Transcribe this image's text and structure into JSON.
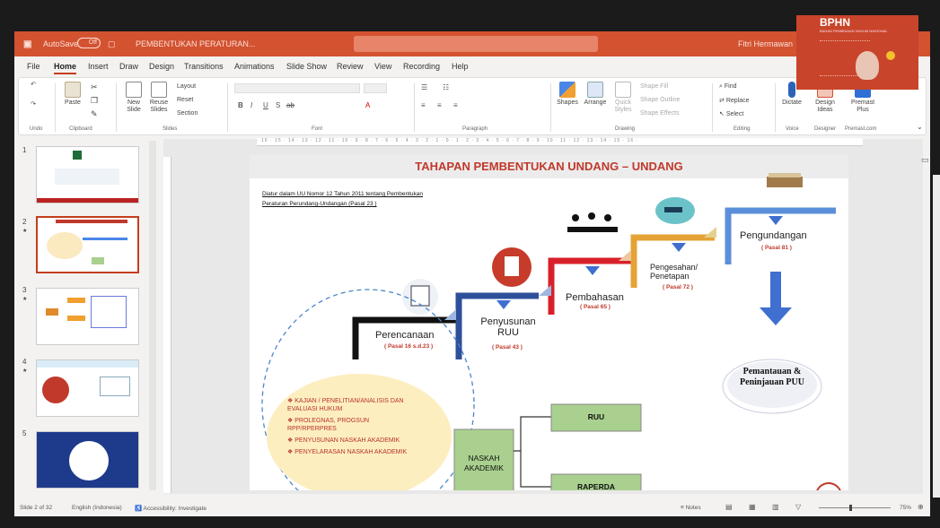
{
  "titlebar": {
    "autosave": "AutoSave",
    "toggle": "Off",
    "doc_title": "PEMBENTUKAN PERATURAN...",
    "user": "Fitri Hermawan"
  },
  "menu": [
    "File",
    "Home",
    "Insert",
    "Draw",
    "Design",
    "Transitions",
    "Animations",
    "Slide Show",
    "Review",
    "View",
    "Recording",
    "Help"
  ],
  "ribbon": {
    "undo": "Undo",
    "paste": "Paste",
    "clipboard": "Clipboard",
    "new_slide": "New Slide",
    "reuse_slides": "Reuse Slides",
    "layout": "Layout",
    "reset": "Reset",
    "section": "Section",
    "slides": "Slides",
    "font": "Font",
    "paragraph": "Paragraph",
    "shapes": "Shapes",
    "arrange": "Arrange",
    "quick_styles": "Quick Styles",
    "shape_fill": "Shape Fill",
    "shape_outline": "Shape Outline",
    "shape_effects": "Shape Effects",
    "drawing": "Drawing",
    "find": "Find",
    "replace": "Replace",
    "select": "Select",
    "editing": "Editing",
    "dictate": "Dictate",
    "voice": "Voice",
    "design_ideas": "Design Ideas",
    "designer": "Designer",
    "premast_plus": "Premast Plus",
    "premast": "Premast.com"
  },
  "ruler": "· 16 · 15 · 14 · 13 · 12 · 11 · 10 · 9 · 8 · 7 · 6 · 5 · 4 · 3 · 2 · 1 · 0 · 1 · 2 · 3 · 4 · 5 · 6 · 7 · 8 · 9 · 10 · 11 · 12 · 13 · 14 · 15 · 16 ·",
  "thumbnails": [
    {
      "num": "1",
      "star": ""
    },
    {
      "num": "2",
      "star": "★"
    },
    {
      "num": "3",
      "star": "★"
    },
    {
      "num": "4",
      "star": "★"
    },
    {
      "num": "5",
      "star": ""
    }
  ],
  "slide": {
    "title": "TAHAPAN PEMBENTUKAN UNDANG – UNDANG",
    "subtitle_line1": "Diatur dalam UU Nomor 12 Tahun 2011 tentang Pembentukan",
    "subtitle_line2": "Peraturan Perundang-Undangan (Pasal 23 )",
    "steps": [
      {
        "label": "Perencanaan",
        "pasal": "( Pasal 16 s.d.23 )"
      },
      {
        "label": "Penyusunan RUU",
        "pasal": "( Pasal 43 )"
      },
      {
        "label": "Pembahasan",
        "pasal": "( Pasal 65 )"
      },
      {
        "label": "Pengesahan/ Penetapan",
        "pasal": "( Pasal 72 )"
      },
      {
        "label": "Pengundangan",
        "pasal": "( Pasal 81 )"
      }
    ],
    "monitoring": "Pemantauan & Peninjauan PUU",
    "bullets": [
      "KAJIAN / PENELITIAN/ANALISIS DAN EVALUASI HUKUM",
      "PROLEGNAS, PROGSUN RPP/RPERPRES",
      "PENYUSUNAN NASKAH AKADEMIK",
      "PENYELARASAN NASKAH AKADEMIK"
    ],
    "naskah": "NASKAH AKADEMIK",
    "ruu": "RUU",
    "raperda": "RAPERDA"
  },
  "status": {
    "slide": "Slide 2 of 32",
    "language": "English (Indonesia)",
    "accessibility": "Accessibility: Investigate",
    "notes": "Notes",
    "zoom": "75%"
  },
  "webcam": {
    "org": "BPHN",
    "tagline": "BADAN PEMBINAAN HUKUM NASIONAL"
  },
  "colors": {
    "brand": "#d35230",
    "accent_red": "#c0392b",
    "blue": "#4a86e8",
    "orange": "#f0a030",
    "green": "#a9d08e"
  }
}
